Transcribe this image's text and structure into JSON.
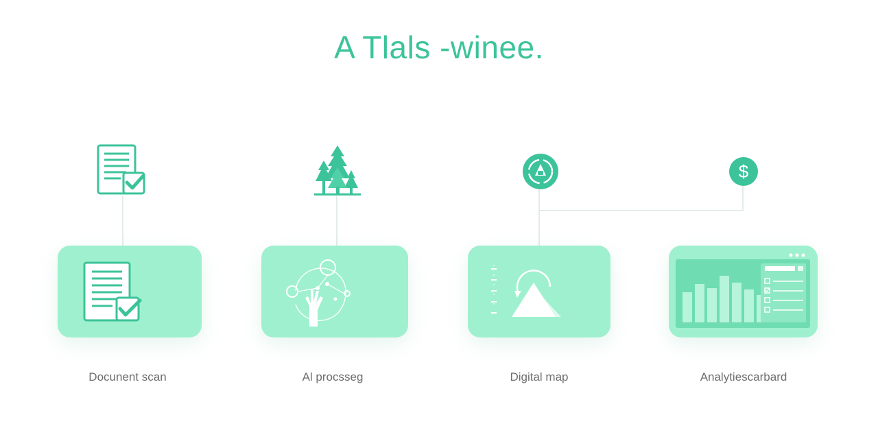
{
  "title": "A Tlals -winee.",
  "steps": [
    {
      "label": "Docunent scan",
      "top_icon": "document-check-icon",
      "card_icon": "document-check-icon"
    },
    {
      "label": "Al procsseg",
      "top_icon": "pine-trees-icon",
      "card_icon": "ai-hand-network-icon"
    },
    {
      "label": "Digital map",
      "top_icon": "badge-circle-icon",
      "card_icon": "map-triangle-icon"
    },
    {
      "label": "Analytiescarbard",
      "top_icon": "dollar-circle-icon",
      "card_icon": "analytics-dashboard-icon"
    }
  ],
  "colors": {
    "accent": "#3cc39a",
    "card_fill": "#9ff0cf",
    "card_inner": "#6fdcb1",
    "caption": "#6e6e6e",
    "connector": "#e3ece8"
  }
}
